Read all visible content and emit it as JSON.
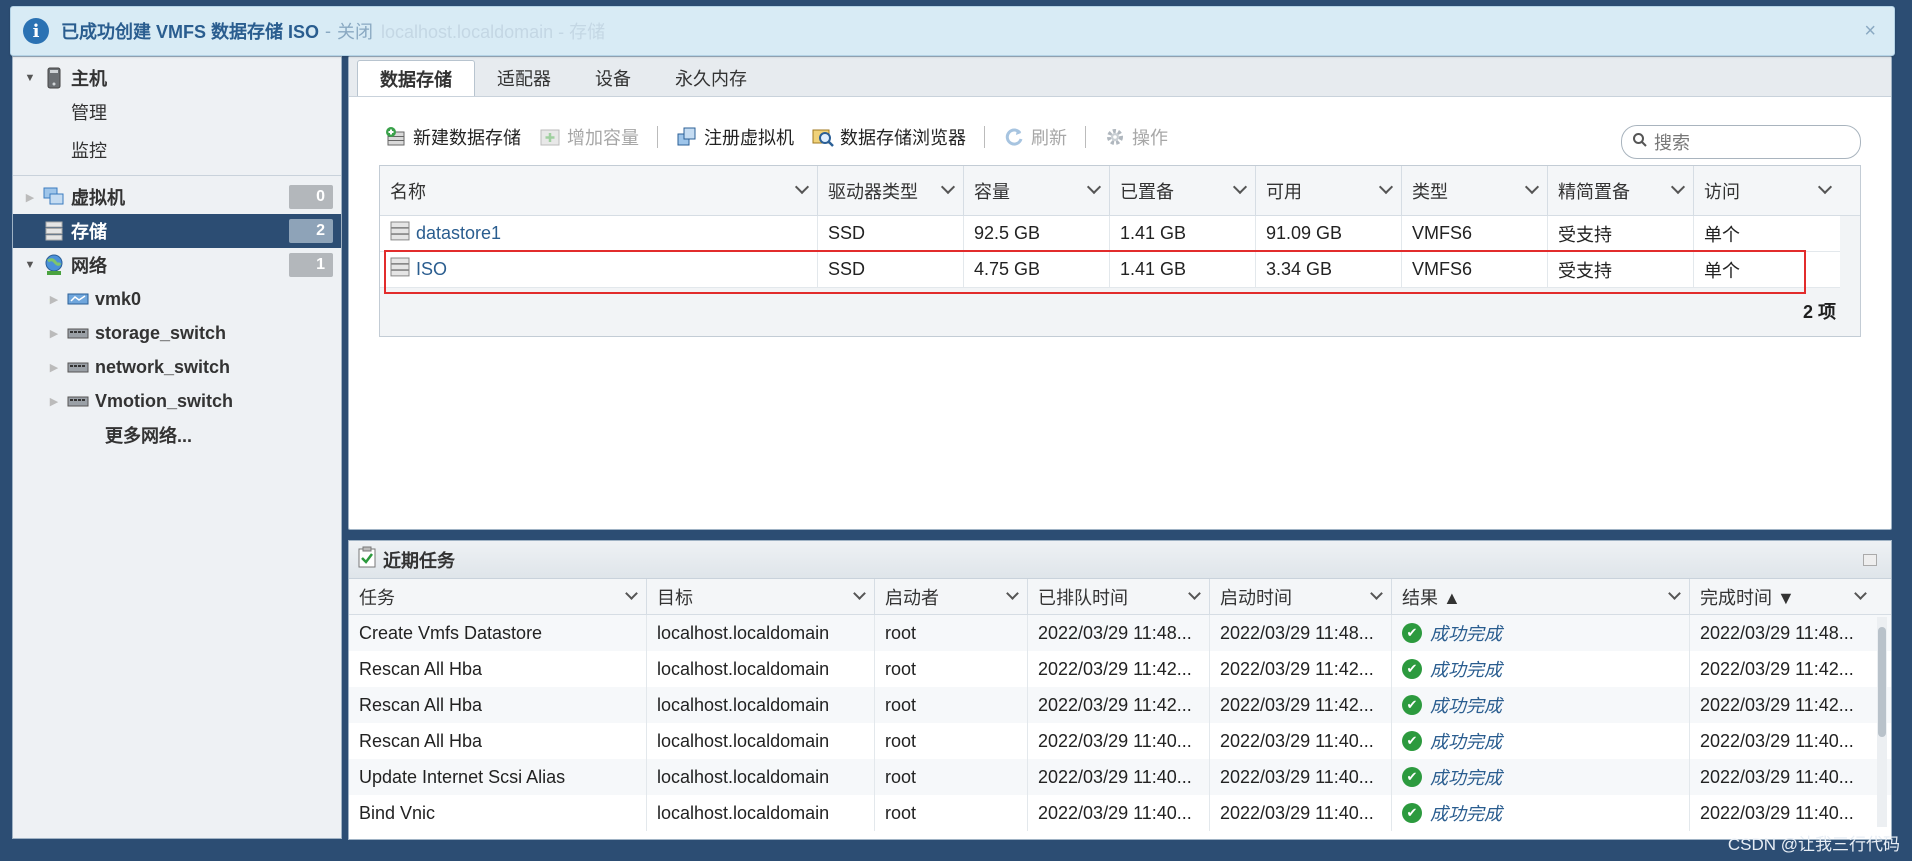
{
  "notification": {
    "message": "已成功创建 VMFS 数据存储 ISO",
    "separator": "-",
    "close_label": "关闭",
    "ghost_text": "localhost.localdomain - 存储",
    "dismiss_glyph": "×"
  },
  "nav": {
    "host_label": "主机",
    "manage_label": "管理",
    "monitor_label": "监控",
    "vm_label": "虚拟机",
    "vm_count": "0",
    "storage_label": "存储",
    "storage_count": "2",
    "network_label": "网络",
    "network_count": "1",
    "network_children": [
      "vmk0",
      "storage_switch",
      "network_switch",
      "Vmotion_switch"
    ],
    "more_networks_label": "更多网络..."
  },
  "tabs": [
    "数据存储",
    "适配器",
    "设备",
    "永久内存"
  ],
  "toolbar": {
    "new_datastore": "新建数据存储",
    "increase_capacity": "增加容量",
    "register_vm": "注册虚拟机",
    "datastore_browser": "数据存储浏览器",
    "refresh": "刷新",
    "actions": "操作",
    "search_placeholder": "搜索"
  },
  "datastore_table": {
    "columns": [
      "名称",
      "驱动器类型",
      "容量",
      "已置备",
      "可用",
      "类型",
      "精简置备",
      "访问"
    ],
    "rows": [
      [
        "datastore1",
        "SSD",
        "92.5 GB",
        "1.41 GB",
        "91.09 GB",
        "VMFS6",
        "受支持",
        "单个"
      ],
      [
        "ISO",
        "SSD",
        "4.75 GB",
        "1.41 GB",
        "3.34 GB",
        "VMFS6",
        "受支持",
        "单个"
      ]
    ],
    "footer": "2 项"
  },
  "tasks": {
    "title": "近期任务",
    "columns": [
      "任务",
      "目标",
      "启动者",
      "已排队时间",
      "启动时间",
      "结果 ▲",
      "完成时间 ▼"
    ],
    "rows": [
      [
        "Create Vmfs Datastore",
        "localhost.localdomain",
        "root",
        "2022/03/29 11:48...",
        "2022/03/29 11:48...",
        "成功完成",
        "2022/03/29 11:48..."
      ],
      [
        "Rescan All Hba",
        "localhost.localdomain",
        "root",
        "2022/03/29 11:42...",
        "2022/03/29 11:42...",
        "成功完成",
        "2022/03/29 11:42..."
      ],
      [
        "Rescan All Hba",
        "localhost.localdomain",
        "root",
        "2022/03/29 11:42...",
        "2022/03/29 11:42...",
        "成功完成",
        "2022/03/29 11:42..."
      ],
      [
        "Rescan All Hba",
        "localhost.localdomain",
        "root",
        "2022/03/29 11:40...",
        "2022/03/29 11:40...",
        "成功完成",
        "2022/03/29 11:40..."
      ],
      [
        "Update Internet Scsi Alias",
        "localhost.localdomain",
        "root",
        "2022/03/29 11:40...",
        "2022/03/29 11:40...",
        "成功完成",
        "2022/03/29 11:40..."
      ],
      [
        "Bind Vnic",
        "localhost.localdomain",
        "root",
        "2022/03/29 11:40...",
        "2022/03/29 11:40...",
        "成功完成",
        "2022/03/29 11:40..."
      ]
    ]
  },
  "watermark": "CSDN @让我三行代码",
  "colors": {
    "accent": "#2c4d73",
    "link": "#2a5d8f",
    "success": "#2c9a3e",
    "highlight_box": "#e22c2c"
  }
}
